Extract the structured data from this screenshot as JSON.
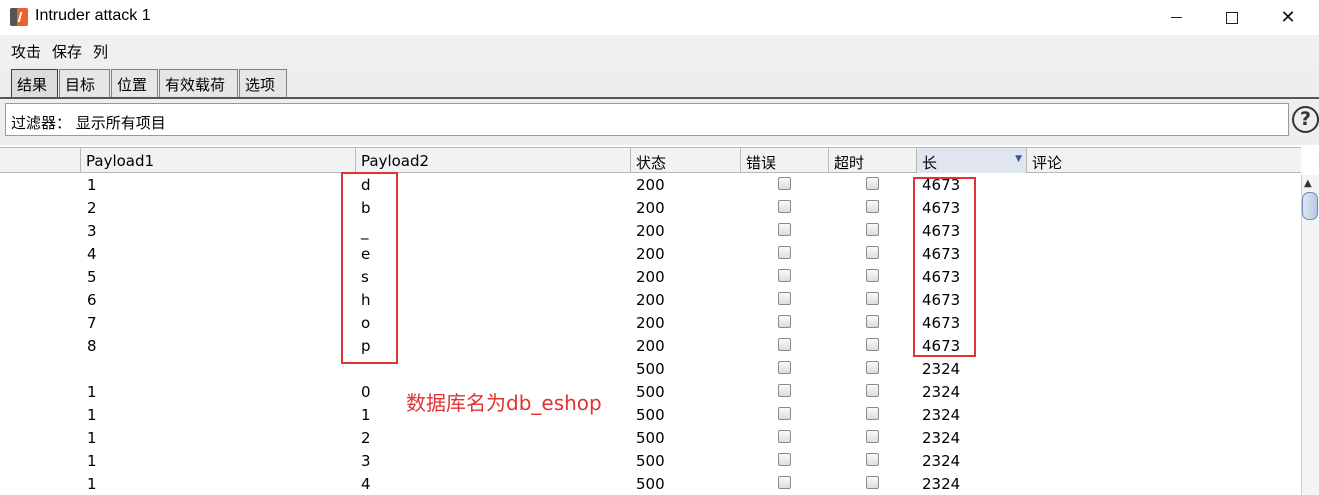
{
  "window": {
    "title": "Intruder attack 1"
  },
  "menu": [
    "攻击",
    "保存",
    "列"
  ],
  "tabs": [
    "结果",
    "目标",
    "位置",
    "有效载荷",
    "选项"
  ],
  "filter": {
    "label": "过滤器：  显示所有项目",
    "help": "?"
  },
  "table": {
    "columns": {
      "request": "",
      "payload1": "Payload1",
      "payload2": "Payload2",
      "status": "状态",
      "error": "错误",
      "timeout": "超时",
      "length": "长",
      "comment": "评论"
    },
    "sorted_column": "长",
    "rows": [
      {
        "p1": "1",
        "p2": "d",
        "status": "200",
        "length": "4673"
      },
      {
        "p1": "2",
        "p2": "b",
        "status": "200",
        "length": "4673"
      },
      {
        "p1": "3",
        "p2": "_",
        "status": "200",
        "length": "4673"
      },
      {
        "p1": "4",
        "p2": "e",
        "status": "200",
        "length": "4673"
      },
      {
        "p1": "5",
        "p2": "s",
        "status": "200",
        "length": "4673"
      },
      {
        "p1": "6",
        "p2": "h",
        "status": "200",
        "length": "4673"
      },
      {
        "p1": "7",
        "p2": "o",
        "status": "200",
        "length": "4673"
      },
      {
        "p1": "8",
        "p2": "p",
        "status": "200",
        "length": "4673"
      },
      {
        "p1": "",
        "p2": "",
        "status": "500",
        "length": "2324"
      },
      {
        "p1": "1",
        "p2": "0",
        "status": "500",
        "length": "2324"
      },
      {
        "p1": "1",
        "p2": "1",
        "status": "500",
        "length": "2324"
      },
      {
        "p1": "1",
        "p2": "2",
        "status": "500",
        "length": "2324"
      },
      {
        "p1": "1",
        "p2": "3",
        "status": "500",
        "length": "2324"
      },
      {
        "p1": "1",
        "p2": "4",
        "status": "500",
        "length": "2324"
      }
    ]
  },
  "annotation": {
    "text": "数据库名为db_eshop",
    "color": "#e03333"
  },
  "colors": {
    "accent_red": "#e03333",
    "app_icon": "#e8622d"
  }
}
